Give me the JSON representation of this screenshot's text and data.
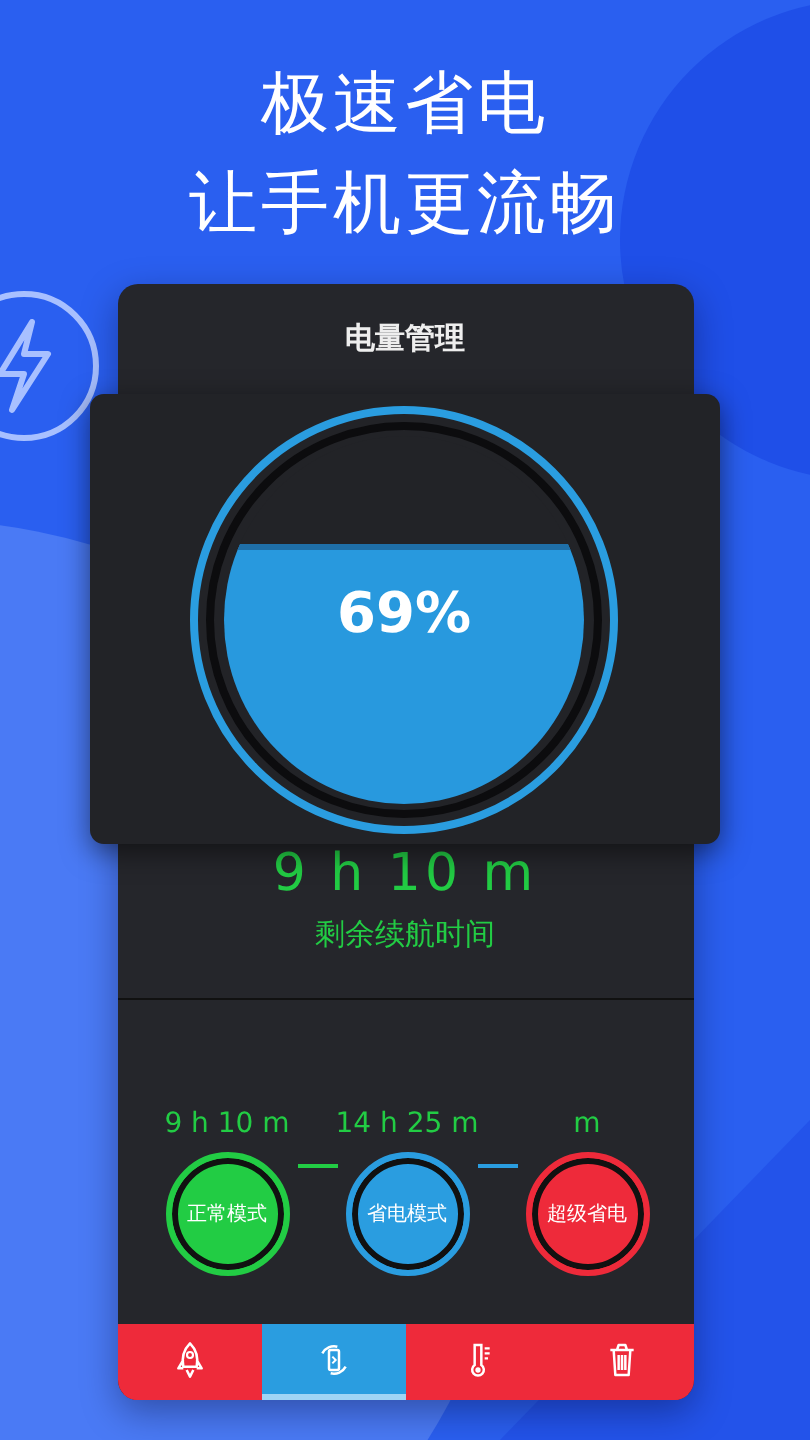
{
  "headline": [
    "极速省电",
    "让手机更流畅"
  ],
  "screen": {
    "title": "电量管理",
    "battery": {
      "level": 0.69,
      "percent": "69%"
    },
    "remaining": {
      "time": "9 h 10 m",
      "label": "剩余续航时间"
    },
    "modes": [
      {
        "time": "9 h 10 m",
        "label": "正常模式",
        "color": "#22cc44"
      },
      {
        "time": "14 h 25 m",
        "label": "省电模式",
        "color": "#2a9de0"
      },
      {
        "time": "m",
        "label": "超级省电",
        "color": "#ee2a3a"
      }
    ],
    "tabs": [
      {
        "kind": "rocket",
        "selected": false
      },
      {
        "kind": "battery",
        "selected": true
      },
      {
        "kind": "thermometer",
        "selected": false
      },
      {
        "kind": "trash",
        "selected": false
      }
    ]
  }
}
